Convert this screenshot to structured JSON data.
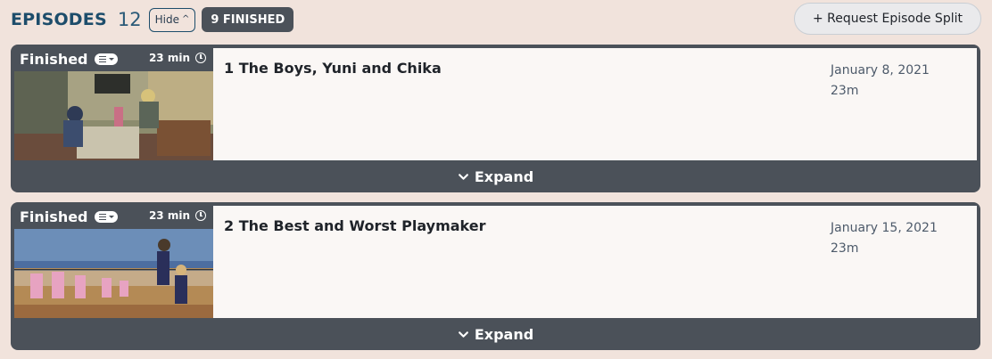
{
  "header": {
    "title": "EPISODES",
    "count": "12",
    "hide_label": "Hide",
    "finished_badge": "9 FINISHED",
    "request_button": "+ Request Episode Split"
  },
  "episodes": [
    {
      "status": "Finished",
      "duration": "23 min",
      "title": "1 The Boys, Yuni and Chika",
      "date": "January 8, 2021",
      "length": "23m",
      "expand_label": "Expand"
    },
    {
      "status": "Finished",
      "duration": "23 min",
      "title": "2 The Best and Worst Playmaker",
      "date": "January 15, 2021",
      "length": "23m",
      "expand_label": "Expand"
    }
  ],
  "colors": {
    "background": "#f1e3dc",
    "card": "#4b5159",
    "title": "#1d4d6b"
  },
  "icons": [
    "chevron-up-icon",
    "list-icon",
    "clock-icon",
    "chevron-down-icon"
  ]
}
